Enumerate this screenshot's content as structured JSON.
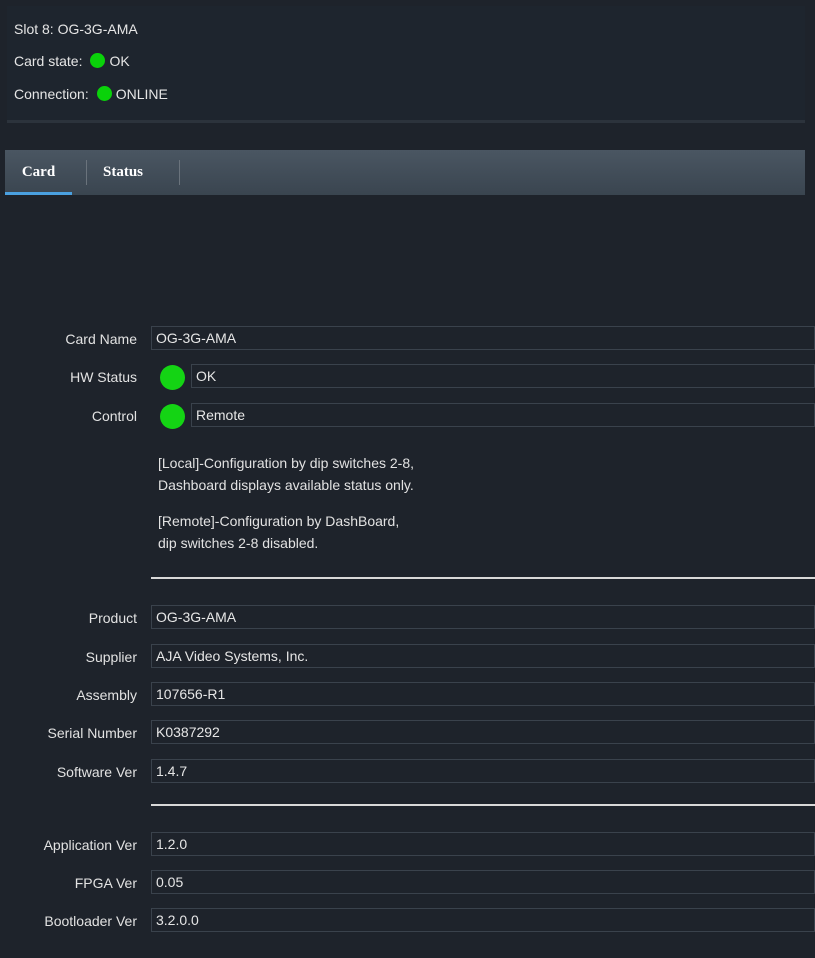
{
  "header": {
    "slot": "Slot 8: OG-3G-AMA",
    "card_state_label": "Card state:",
    "card_state_value": "OK",
    "connection_label": "Connection:",
    "connection_value": "ONLINE"
  },
  "tabs": [
    {
      "label": "Card"
    },
    {
      "label": "Status"
    }
  ],
  "card": {
    "card_name_label": "Card Name",
    "card_name_value": "OG-3G-AMA",
    "hw_status_label": "HW Status",
    "hw_status_value": "OK",
    "control_label": "Control",
    "control_value": "Remote",
    "note_local_1": "[Local]-Configuration by dip switches 2-8,",
    "note_local_2": "Dashboard displays available status only.",
    "note_remote_1": "[Remote]-Configuration by DashBoard,",
    "note_remote_2": "dip switches 2-8 disabled.",
    "product_label": "Product",
    "product_value": "OG-3G-AMA",
    "supplier_label": "Supplier",
    "supplier_value": "AJA Video Systems, Inc.",
    "assembly_label": "Assembly",
    "assembly_value": "107656-R1",
    "serial_label": "Serial Number",
    "serial_value": "K0387292",
    "software_label": "Software Ver",
    "software_value": "1.4.7",
    "application_label": "Application Ver",
    "application_value": "1.2.0",
    "fpga_label": "FPGA Ver",
    "fpga_value": "0.05",
    "bootloader_label": "Bootloader Ver",
    "bootloader_value": "3.2.0.0"
  },
  "colors": {
    "led_ok": "#14d414",
    "tab_active_underline": "#4aa0e0"
  }
}
